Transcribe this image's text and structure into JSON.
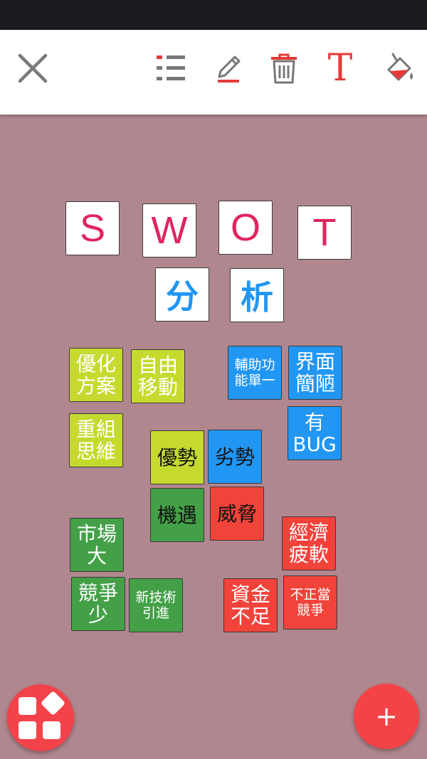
{
  "colors": {
    "background": "#b0878e",
    "accent_red": "#f2433b",
    "letter_pink": "#e0245e",
    "cn_blue": "#2196f3",
    "note_yellow": "#c6d92f",
    "note_blue": "#2196f3",
    "note_green": "#43a047",
    "note_red": "#f2433b"
  },
  "toolbar": {
    "close_icon": "close-icon",
    "list_icon": "list-icon",
    "pen_icon": "pen-icon",
    "trash_icon": "trash-icon",
    "text_label": "T",
    "fill_icon": "paint-bucket-icon"
  },
  "title_letters": [
    "S",
    "W",
    "O",
    "T"
  ],
  "title_chars": [
    "分",
    "析"
  ],
  "notes": {
    "optimize": "優化\n方案",
    "free_move": "自由\n移動",
    "restructure": "重組\n思維",
    "strengths": "優勢",
    "weaknesses": "劣勢",
    "opportunities": "機遇",
    "threats": "威脅",
    "aux_single": "輔助功\n能單一",
    "ui_crude": "界面\n簡陋",
    "has_bug": "有\nBUG",
    "big_market": "市場\n大",
    "less_competition": "競爭\n少",
    "new_tech": "新技術\n引進",
    "economy_weak": "經濟\n疲軟",
    "lack_funds": "資金\n不足",
    "unfair_competition": "不正當\n競爭"
  },
  "fab": {
    "apps_icon": "apps-icon",
    "add_label": "+"
  }
}
